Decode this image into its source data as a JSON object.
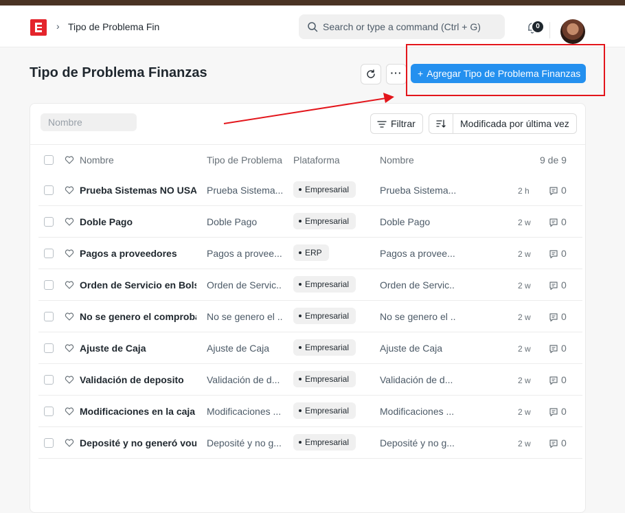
{
  "navbar": {
    "breadcrumb": "Tipo de Problema Fina",
    "search_placeholder": "Search or type a command (Ctrl + G)",
    "notification_count": "0"
  },
  "page": {
    "title": "Tipo de Problema Finanzas",
    "more_label": "···",
    "add_button": "Agregar Tipo de Problema Finanzas"
  },
  "filters": {
    "name_placeholder": "Nombre",
    "filter_label": "Filtrar",
    "sort_label": "Modificada por última vez"
  },
  "list": {
    "columns": {
      "name": "Nombre",
      "tipo": "Tipo de Problema",
      "plataforma": "Plataforma",
      "nombre": "Nombre",
      "count": "9 de 9"
    },
    "rows": [
      {
        "name": "Prueba Sistemas NO USAR",
        "tipo": "Prueba Sistema...",
        "plataforma": "Empresarial",
        "nombre": "Prueba Sistema...",
        "time": "2 h",
        "comments": "0"
      },
      {
        "name": "Doble Pago",
        "tipo": "Doble Pago",
        "plataforma": "Empresarial",
        "nombre": "Doble Pago",
        "time": "2 w",
        "comments": "0"
      },
      {
        "name": "Pagos a proveedores",
        "tipo": "Pagos a provee...",
        "plataforma": "ERP",
        "nombre": "Pagos a provee...",
        "time": "2 w",
        "comments": "0"
      },
      {
        "name": "Orden de Servicio en Bolsa",
        "tipo": "Orden de Servic...",
        "plataforma": "Empresarial",
        "nombre": "Orden de Servic...",
        "time": "2 w",
        "comments": "0"
      },
      {
        "name": "No se genero el comprobar",
        "tipo": "No se genero el ...",
        "plataforma": "Empresarial",
        "nombre": "No se genero el ...",
        "time": "2 w",
        "comments": "0"
      },
      {
        "name": "Ajuste de Caja",
        "tipo": "Ajuste de Caja",
        "plataforma": "Empresarial",
        "nombre": "Ajuste de Caja",
        "time": "2 w",
        "comments": "0"
      },
      {
        "name": "Validación de deposito",
        "tipo": "Validación de d...",
        "plataforma": "Empresarial",
        "nombre": "Validación de d...",
        "time": "2 w",
        "comments": "0"
      },
      {
        "name": "Modificaciones en la caja d",
        "tipo": "Modificaciones ...",
        "plataforma": "Empresarial",
        "nombre": "Modificaciones ...",
        "time": "2 w",
        "comments": "0"
      },
      {
        "name": "Deposité y no generó voucl",
        "tipo": "Deposité y no g...",
        "plataforma": "Empresarial",
        "nombre": "Deposité y no g...",
        "time": "2 w",
        "comments": "0"
      }
    ]
  },
  "colors": {
    "primary": "#2490ef",
    "annotation": "#e3151b",
    "logo": "#e4242b"
  }
}
